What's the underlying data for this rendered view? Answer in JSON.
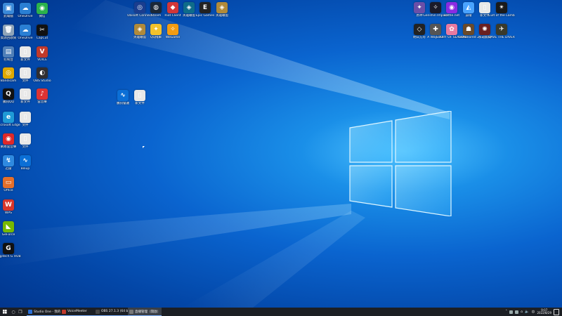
{
  "desktop": {
    "icons_left": [
      {
        "label": "此電腦",
        "glyph": "▣",
        "color": "#3b8ad9"
      },
      {
        "label": "OneDrive",
        "glyph": "☁",
        "color": "#2a7fd4"
      },
      {
        "label": "微信",
        "glyph": "◉",
        "color": "#2bb24c"
      },
      {
        "label": "資源回收筒",
        "glyph": "🗑",
        "color": "#8fa4b8"
      },
      {
        "label": "OneDrive",
        "glyph": "☁",
        "color": "#2a7fd4"
      },
      {
        "label": "CapCut",
        "glyph": "✂",
        "color": "#111"
      },
      {
        "label": "控制台",
        "glyph": "▤",
        "color": "#4f7fb8"
      },
      {
        "label": "新文件",
        "glyph": "▯",
        "color": "#e8e8e8"
      },
      {
        "label": "VOICE",
        "glyph": "V",
        "color": "#c0392b"
      },
      {
        "label": "Bandicam",
        "glyph": "◎",
        "color": "#e0a800"
      },
      {
        "label": "文件",
        "glyph": "▯",
        "color": "#e8e8e8"
      },
      {
        "label": "OBS Studio",
        "glyph": "◐",
        "color": "#302e31"
      },
      {
        "label": "騰訊QQ",
        "glyph": "Q",
        "color": "#111"
      },
      {
        "label": "新文件",
        "glyph": "▯",
        "color": "#e8e8e8"
      },
      {
        "label": "雲音樂",
        "glyph": "♪",
        "color": "#d33"
      },
      {
        "label": "Microsoft Edge",
        "glyph": "e",
        "color": "#1f9ad6"
      },
      {
        "label": "文件",
        "glyph": "▯",
        "color": "#e8e8e8"
      },
      {
        "label": "網易雲音樂",
        "glyph": "◉",
        "color": "#e02828"
      },
      {
        "label": "文件",
        "glyph": "▯",
        "color": "#e8e8e8"
      },
      {
        "label": "迅雷",
        "glyph": "↯",
        "color": "#2f8ae0"
      },
      {
        "label": "Biliup",
        "glyph": "∿",
        "color": "#0b6fd6"
      },
      {
        "label": "Office",
        "glyph": "▭",
        "color": "#e56f2a"
      },
      {
        "label": "WPS",
        "glyph": "W",
        "color": "#d9362b"
      },
      {
        "label": "GeForce",
        "glyph": "◣",
        "color": "#76b900"
      },
      {
        "label": "Logitech G HUB",
        "glyph": "G",
        "color": "#111"
      }
    ],
    "icons_mid": [
      {
        "label": "Ubisoft Connect",
        "glyph": "◎",
        "color": "#1a3d8f"
      },
      {
        "label": "Steam",
        "glyph": "◍",
        "color": "#1b2838"
      },
      {
        "label": "Riot Client",
        "glyph": "◆",
        "color": "#d13639"
      },
      {
        "label": "英雄聯盟",
        "glyph": "◈",
        "color": "#0e6c8a"
      },
      {
        "label": "Epic Games",
        "glyph": "E",
        "color": "#222"
      },
      {
        "label": "英雄聯盟",
        "glyph": "◈",
        "color": "#b08a3a"
      },
      {
        "label": "英雄聯盟",
        "glyph": "◈",
        "color": "#b08a3a"
      },
      {
        "label": "QQ飛車",
        "glyph": "✦",
        "color": "#f3c22c"
      },
      {
        "label": "WeGame",
        "glyph": "✧",
        "color": "#f39c12"
      },
      {
        "label": "騰訊會議",
        "glyph": "∿",
        "color": "#0b6fd6"
      },
      {
        "label": "新文件",
        "glyph": "▯",
        "color": "#e8e8e8"
      }
    ],
    "icons_right": [
      {
        "label": "原神",
        "glyph": "✦",
        "color": "#6b4fa8"
      },
      {
        "label": "Genshin Impact",
        "glyph": "✧",
        "color": "#1a1a2a"
      },
      {
        "label": "Battle.net",
        "glyph": "◉",
        "color": "#8a2be2"
      },
      {
        "label": "崩壞",
        "glyph": "◭",
        "color": "#4aa3ff"
      },
      {
        "label": "新文件",
        "glyph": "▯",
        "color": "#e8e8e8"
      },
      {
        "label": "Cult of the Lamb",
        "glyph": "✴",
        "color": "#1a1a1a"
      },
      {
        "label": "明日方舟",
        "glyph": "◇",
        "color": "#222"
      },
      {
        "label": "A Way Out",
        "glyph": "✚",
        "color": "#555"
      },
      {
        "label": "STORY OF SEASONS",
        "glyph": "✿",
        "color": "#e87aa0"
      },
      {
        "label": "Dishonored 2",
        "glyph": "☗",
        "color": "#6a4a2a"
      },
      {
        "label": "永劫無間",
        "glyph": "✺",
        "color": "#6a2020"
      },
      {
        "label": "DAVE THE DIVER",
        "glyph": "✈",
        "color": "#3a3a2a"
      }
    ]
  },
  "taskbar": {
    "apps": [
      {
        "label": "Studio One - 我的...",
        "color": "#2a6fd6",
        "active": false
      },
      {
        "label": "VoiceMeeter",
        "color": "#c0392b",
        "active": false
      },
      {
        "label": "OBS 27.1.3 (64 bit)...",
        "color": "#444",
        "active": false
      },
      {
        "label": "直播管理（開啟）",
        "color": "#777",
        "active": true
      }
    ],
    "clock_time": "9:07",
    "clock_date": "2022/8/29",
    "start_label": "⊞",
    "search_glyph": "○",
    "taskview_glyph": "❐",
    "lang": "中"
  }
}
